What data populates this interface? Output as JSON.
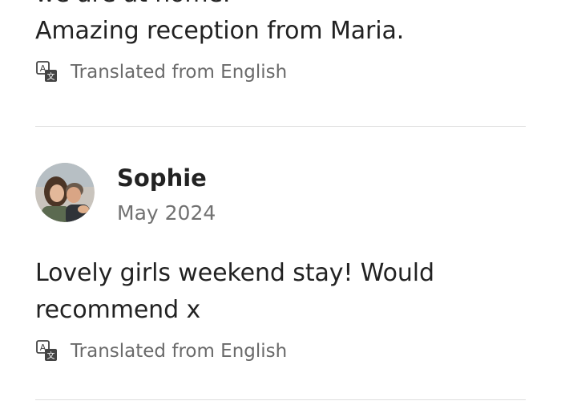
{
  "reviews": [
    {
      "text_lines": [
        "we are at home.",
        "Amazing reception from Maria."
      ],
      "translated_label": "Translated from English",
      "translate_icon": "translate-icon"
    },
    {
      "reviewer_name": "Sophie",
      "date": "May 2024",
      "avatar_icon": "avatar-photo",
      "text_lines": [
        "Lovely girls weekend stay! Would",
        "recommend x"
      ],
      "translated_label": "Translated from English",
      "translate_icon": "translate-icon"
    }
  ],
  "colors": {
    "text_primary": "#222222",
    "text_secondary": "#717171",
    "divider": "#dddddd"
  }
}
